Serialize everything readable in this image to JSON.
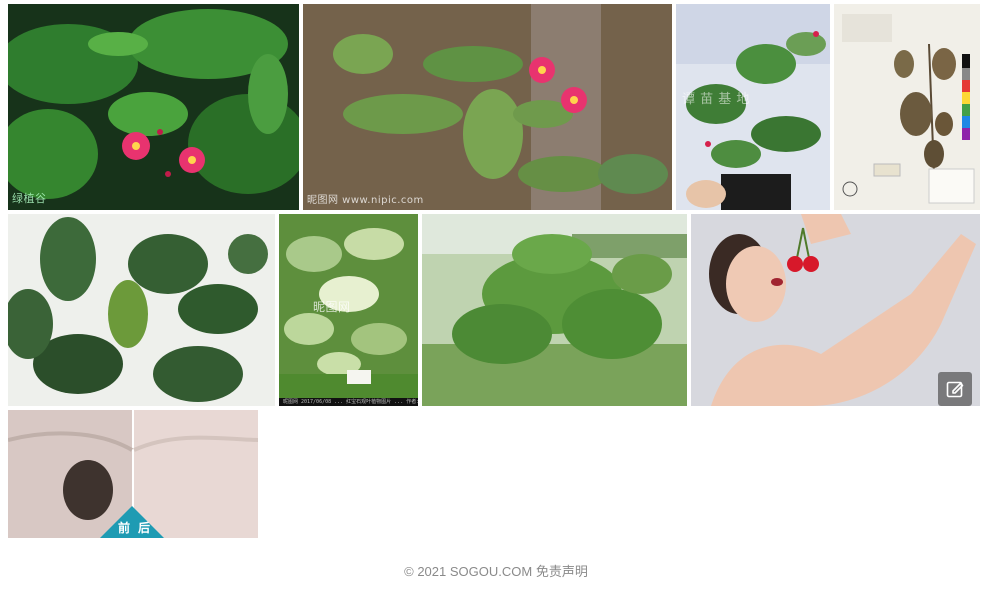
{
  "results": {
    "watermarks": {
      "flower_left": "绿植谷",
      "flower_center": "昵图网 www.nipic.com",
      "pot_plant": "谭 苗 基 地",
      "ficus_variegated": "昵图网",
      "ficus_variegated_strip": "昵图网 2017/06/08 ... 红宝石观叶植物图片 ... 作者:绿植"
    },
    "icons": {
      "edit": "edit-icon"
    },
    "before_after": {
      "before_label": "前",
      "after_label": "后"
    }
  },
  "footer": {
    "copyright": "© 2021 SOGOU.COM",
    "disclaimer": "免责声明"
  },
  "colors": {
    "flower_pink": "#e8336f",
    "teal_badge": "#1e9bb3",
    "footer_text": "#8a8a8a"
  }
}
